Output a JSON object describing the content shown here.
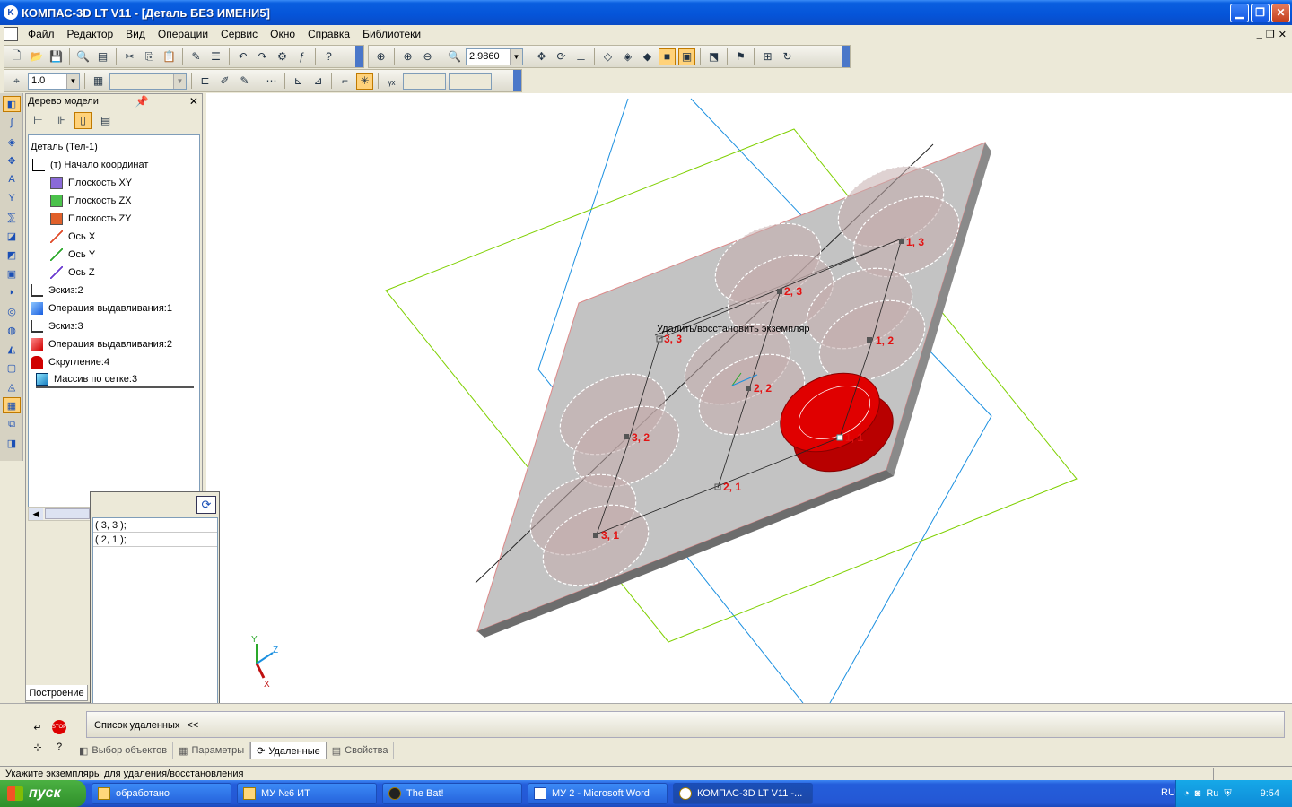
{
  "window": {
    "title": "КОМПАС-3D LT V11 - [Деталь БЕЗ ИМЕНИ5]",
    "app_icon": "K"
  },
  "menu": [
    "Файл",
    "Редактор",
    "Вид",
    "Операции",
    "Сервис",
    "Окно",
    "Справка",
    "Библиотеки"
  ],
  "toolbar": {
    "zoom_value": "2.9860",
    "step_value": "1.0"
  },
  "model_tree": {
    "header": "Дерево модели",
    "items": [
      "Деталь (Тел-1)",
      "(т) Начало координат",
      "Плоскость XY",
      "Плоскость ZX",
      "Плоскость ZY",
      "Ось X",
      "Ось Y",
      "Ось Z",
      "Эскиз:2",
      "Операция выдавливания:1",
      "Эскиз:3",
      "Операция выдавливания:2",
      "Скругление:4",
      "Массив по сетке:3"
    ],
    "bottom_tab": "Построение"
  },
  "deleted_popup": {
    "rows": [
      "( 3, 3 );",
      "( 2, 1 );"
    ]
  },
  "viewport": {
    "hint": "Удалить/восстановить экземпляр",
    "instance_labels": [
      "1, 3",
      "2, 3",
      "3, 3",
      "1, 2",
      "2, 2",
      "3, 2",
      "1, 1",
      "2, 1",
      "3, 1"
    ],
    "axis_labels": {
      "x": "X",
      "y": "Y",
      "z": "Z"
    },
    "colors": {
      "plate": "#c3c3c3",
      "red_body": "#e00000",
      "green_plane": "#7fd000",
      "blue_plane": "#1a8fe0",
      "label": "#e31212"
    }
  },
  "property_bar": {
    "list_button": "Список удаленных",
    "list_chevrons": "<<",
    "tabs": [
      "Выбор объектов",
      "Параметры",
      "Удаленные",
      "Свойства"
    ],
    "active_tab": "Удаленные"
  },
  "status": "Укажите экземпляры для удаления/восстановления",
  "taskbar": {
    "start": "пуск",
    "buttons": [
      "обработано",
      "МУ №6 ИТ",
      "The Bat!",
      "МУ 2 - Microsoft Word",
      "КОМПАС-3D LT V11 -..."
    ],
    "lang": "RU",
    "tray_lang": "Ru",
    "clock": "9:54"
  }
}
